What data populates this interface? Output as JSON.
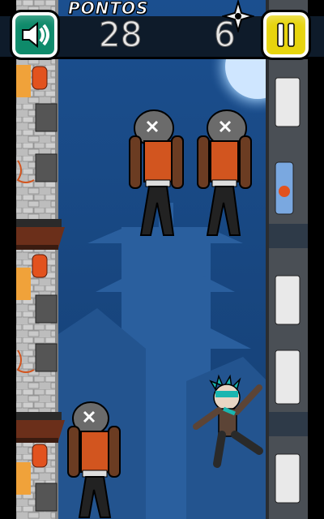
{
  "hud": {
    "points_label": "PONTOS",
    "score": "28",
    "kills": "6"
  },
  "buttons": {
    "sound": "sound-on-icon",
    "pause": "pause-icon"
  },
  "colors": {
    "sky": "#1a4a86",
    "moon": "#cfe6ff",
    "sound_button": "#0e8a6a",
    "pause_button": "#e7d40d",
    "ninja_orange": "#d2551f",
    "player_hair": "#19b6b0"
  }
}
